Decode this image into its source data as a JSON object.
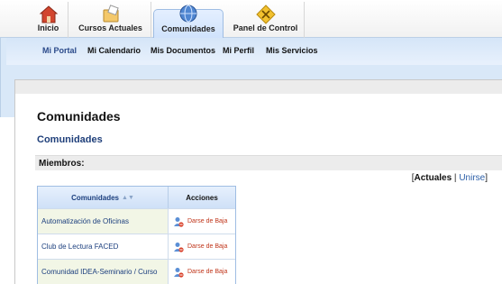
{
  "top_tabs": [
    {
      "label": "Inicio",
      "icon": "home-icon"
    },
    {
      "label": "Cursos Actuales",
      "icon": "courses-icon"
    },
    {
      "label": "Comunidades",
      "icon": "globe-icon",
      "active": true
    },
    {
      "label": "Panel de Control",
      "icon": "control-panel-icon"
    }
  ],
  "subnav": {
    "items": [
      "Mi Portal",
      "Mi Calendario",
      "Mis Documentos",
      "Mi Perfil",
      "Mis Servicios"
    ],
    "active_index": 0
  },
  "page": {
    "title": "Comunidades",
    "subtitle": "Comunidades",
    "members_label": "Miembros:"
  },
  "filter": {
    "open_bracket": "[",
    "current": "Actuales",
    "separator": " | ",
    "link": "Unirse",
    "close_bracket": "]"
  },
  "table": {
    "col_name": "Comunidades",
    "col_actions": "Acciones",
    "rows": [
      {
        "name": "Automatización de Oficinas",
        "action": "Darse de Baja"
      },
      {
        "name": "Club de Lectura FACED",
        "action": "Darse de Baja"
      },
      {
        "name": "Comunidad IDEA-Seminario / Curso",
        "action": "Darse de Baja"
      }
    ]
  },
  "colors": {
    "accent": "#1f3f7a",
    "link": "#2b5ea7",
    "action": "#c0361b",
    "nav_bg": "#d9e8f8"
  }
}
